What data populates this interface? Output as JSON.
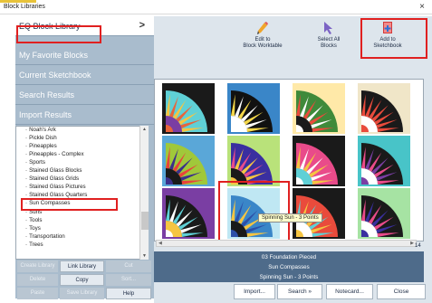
{
  "window": {
    "title": "Block Libraries",
    "close": "×"
  },
  "sidebar": {
    "categories": [
      {
        "label": "EQ Block Library",
        "chevron": ">"
      },
      {
        "label": "My Favorite Blocks"
      },
      {
        "label": "Current Sketchbook"
      },
      {
        "label": "Search Results"
      },
      {
        "label": "Import Results"
      }
    ],
    "tree": [
      "Noah's Ark",
      "Pickle Dish",
      "Pineapples",
      "Pineapples - Complex",
      "Sports",
      "Stained Glass Blocks",
      "Stained Glass Grids",
      "Stained Glass Pictures",
      "Stained Glass Quarters",
      "Sun Compasses",
      "Suns",
      "Tools",
      "Toys",
      "Transportation",
      "Trees"
    ],
    "selected": "Sun Compasses",
    "buttons": [
      "Create Library",
      "Link Library",
      "Cut",
      "Delete",
      "Copy",
      "Sort...",
      "Paste",
      "Save Library",
      "Help"
    ]
  },
  "toolbar": {
    "edit": {
      "line1": "Edit to",
      "line2": "Block Worktable",
      "icon": "pencil-icon"
    },
    "select_all": {
      "line1": "Select All",
      "line2": "Blocks",
      "icon": "cursor-icon"
    },
    "add": {
      "line1": "Add to",
      "line2": "Sketchbook",
      "icon": "add-book-icon"
    }
  },
  "grid": {
    "tooltip": "Spinning Sun - 3 Points",
    "page": "14",
    "blocks": [
      {
        "bg": "#1a1a1a",
        "ring": "#5fd0d6",
        "fan": "#f5c542",
        "inner": "#7a3ea3",
        "accent": "#e8643a"
      },
      {
        "bg": "#3a86c8",
        "ring": "#111111",
        "fan": "#f4d74a",
        "inner": "#ffffff",
        "accent": "#ffffff"
      },
      {
        "bg": "#ffe9a8",
        "ring": "#3f8a3a",
        "fan": "#e94b3c",
        "inner": "#1a1a1a",
        "accent": "#ffffff"
      },
      {
        "bg": "#f0e6c8",
        "ring": "#1a1a1a",
        "fan": "#e94b3c",
        "inner": "#ffffff",
        "accent": "#e94b3c"
      },
      {
        "bg": "#5aa7d8",
        "ring": "#a0c83a",
        "fan": "#e8433a",
        "inner": "#1a1a1a",
        "accent": "#3c2f8a"
      },
      {
        "bg": "#b9e27a",
        "ring": "#3a2fa0",
        "fan": "#e94b8a",
        "inner": "#1a1a1a",
        "accent": "#f5c542"
      },
      {
        "bg": "#1a1a1a",
        "ring": "#e94b8a",
        "fan": "#f5c542",
        "inner": "#5fd0d6",
        "accent": "#ffffff"
      },
      {
        "bg": "#48c4c8",
        "ring": "#1a1a1a",
        "fan": "#e94b8a",
        "inner": "#ffffff",
        "accent": "#7a3ea3"
      },
      {
        "bg": "#7a3ea3",
        "ring": "#1a1a1a",
        "fan": "#5fd0d6",
        "inner": "#f5c542",
        "accent": "#ffffff"
      },
      {
        "bg": "#bfe7f3",
        "ring": "#3a86c8",
        "fan": "#f5c542",
        "inner": "#1a1a1a",
        "accent": "#2c4fa8"
      },
      {
        "bg": "#1a1a1a",
        "ring": "#e94b3c",
        "fan": "#5fd0d6",
        "inner": "#ffffff",
        "accent": "#f5c542"
      },
      {
        "bg": "#a6e3a3",
        "ring": "#1a1a1a",
        "fan": "#e94b8a",
        "inner": "#ffffff",
        "accent": "#3a2fa0"
      }
    ]
  },
  "status": {
    "line1": "03 Foundation Pieced",
    "line2": "Sun Compasses",
    "line3": "Spinning Sun - 3 Points"
  },
  "bottom": {
    "import": "Import...",
    "search": "Search »",
    "notecard": "Notecard...",
    "close": "Close"
  },
  "colors": {
    "sidebar_bg": "#a9bccd",
    "panel_bg": "#dde5ec",
    "highlight": "#e02020",
    "accent": "#2f6fd6"
  }
}
